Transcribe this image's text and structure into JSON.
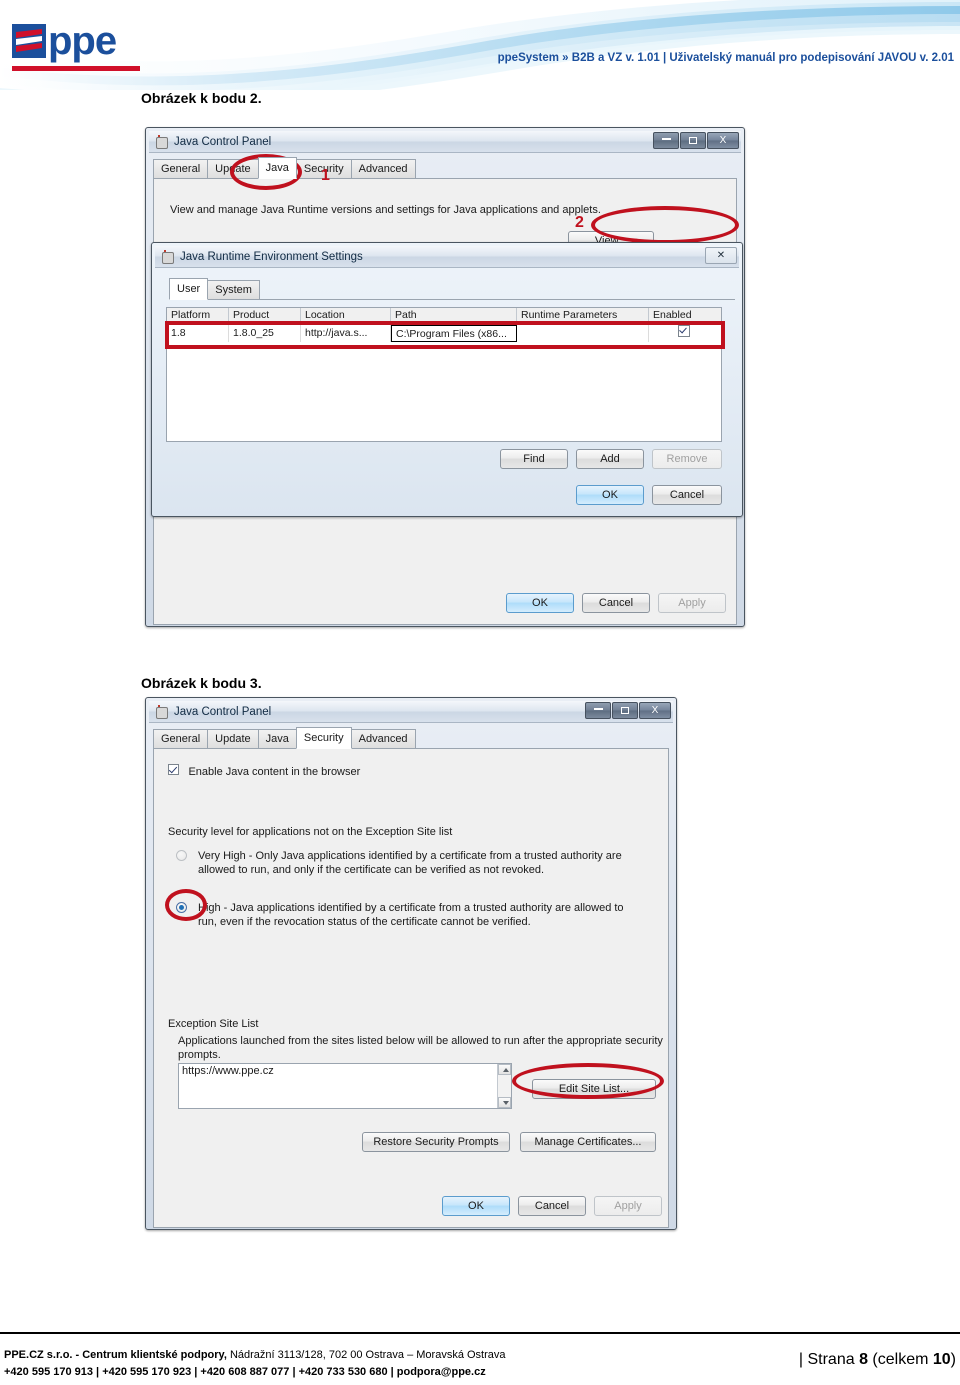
{
  "header": {
    "logo_word": "ppe",
    "logo_alt": "ppe-logo",
    "title": "ppeSystem » B2B a VZ v. 1.01 |  Uživatelský manuál pro podepisování JAVOU v. 2.01",
    "brand_blue": "#1b4f9c",
    "brand_red": "#d0102a"
  },
  "captions": {
    "fig2": "Obrázek k bodu 2.",
    "fig3": "Obrázek k bodu 3."
  },
  "figure2": {
    "control_panel": {
      "title": "Java Control Panel",
      "window_buttons": {
        "minimize": "–",
        "maximize": "□",
        "close": "X"
      },
      "tabs": [
        {
          "label": "General",
          "active": false
        },
        {
          "label": "Update",
          "active": false
        },
        {
          "label": "Java",
          "active": true
        },
        {
          "label": "Security",
          "active": false
        },
        {
          "label": "Advanced",
          "active": false
        }
      ],
      "description": "View and manage Java Runtime versions and settings for Java applications and applets.",
      "view_button": "View...",
      "buttons": {
        "ok": "OK",
        "cancel": "Cancel",
        "apply": "Apply"
      },
      "annotations": {
        "step1": "1",
        "step2": "2"
      }
    },
    "jre_settings": {
      "title": "Java Runtime Environment Settings",
      "close_glyph": "✕",
      "tabs": [
        {
          "label": "User",
          "active": true
        },
        {
          "label": "System",
          "active": false
        }
      ],
      "table": {
        "columns": [
          "Platform",
          "Product",
          "Location",
          "Path",
          "Runtime Parameters",
          "Enabled"
        ],
        "rows": [
          {
            "platform": "1.8",
            "product": "1.8.0_25",
            "location": "http://java.s...",
            "path": "C:\\Program Files (x86...",
            "runtime_parameters": "",
            "enabled": true
          }
        ]
      },
      "buttons": {
        "find": "Find",
        "add": "Add",
        "remove": "Remove",
        "ok": "OK",
        "cancel": "Cancel"
      }
    }
  },
  "figure3": {
    "title": "Java Control Panel",
    "window_buttons": {
      "minimize": "–",
      "maximize": "□",
      "close": "X"
    },
    "tabs": [
      {
        "label": "General",
        "active": false
      },
      {
        "label": "Update",
        "active": false
      },
      {
        "label": "Java",
        "active": false
      },
      {
        "label": "Security",
        "active": true
      },
      {
        "label": "Advanced",
        "active": false
      }
    ],
    "enable_java_checkbox": {
      "label": "Enable Java content in the browser",
      "checked": true
    },
    "security_level_label": "Security level for applications not on the Exception Site list",
    "security_levels": [
      {
        "id": "very-high",
        "selected": false,
        "line1": "Very High - Only Java applications identified by a certificate from a trusted authority are",
        "line2": "allowed to run, and only if the certificate can be verified as not revoked."
      },
      {
        "id": "high",
        "selected": true,
        "line1": "High - Java applications identified by a certificate from a trusted authority are allowed to",
        "line2": "run, even if the revocation status of the certificate cannot be verified."
      }
    ],
    "exception_site_list": {
      "label": "Exception Site List",
      "description_line1": "Applications launched from the sites listed below will be allowed to run after the appropriate security",
      "description_line2": "prompts.",
      "sites": [
        "https://www.ppe.cz"
      ],
      "edit_button": "Edit Site List..."
    },
    "action_buttons": {
      "restore": "Restore Security Prompts",
      "manage_certificates": "Manage Certificates..."
    },
    "buttons": {
      "ok": "OK",
      "cancel": "Cancel",
      "apply": "Apply"
    }
  },
  "footer": {
    "company_bold": "PPE.CZ s.r.o. - Centrum klientské podpory,",
    "address": " Nádražní 3113/128, 702 00  Ostrava – Moravská Ostrava",
    "contacts": "+420 595 170 913 |  +420 595 170 923 |  +420 608 887 077 |  +420 733 530 680 |  podpora@ppe.cz",
    "page_prefix": "|  Strana ",
    "page_current": "8",
    "page_mid": " (celkem ",
    "page_total": "10",
    "page_suffix": ")"
  }
}
